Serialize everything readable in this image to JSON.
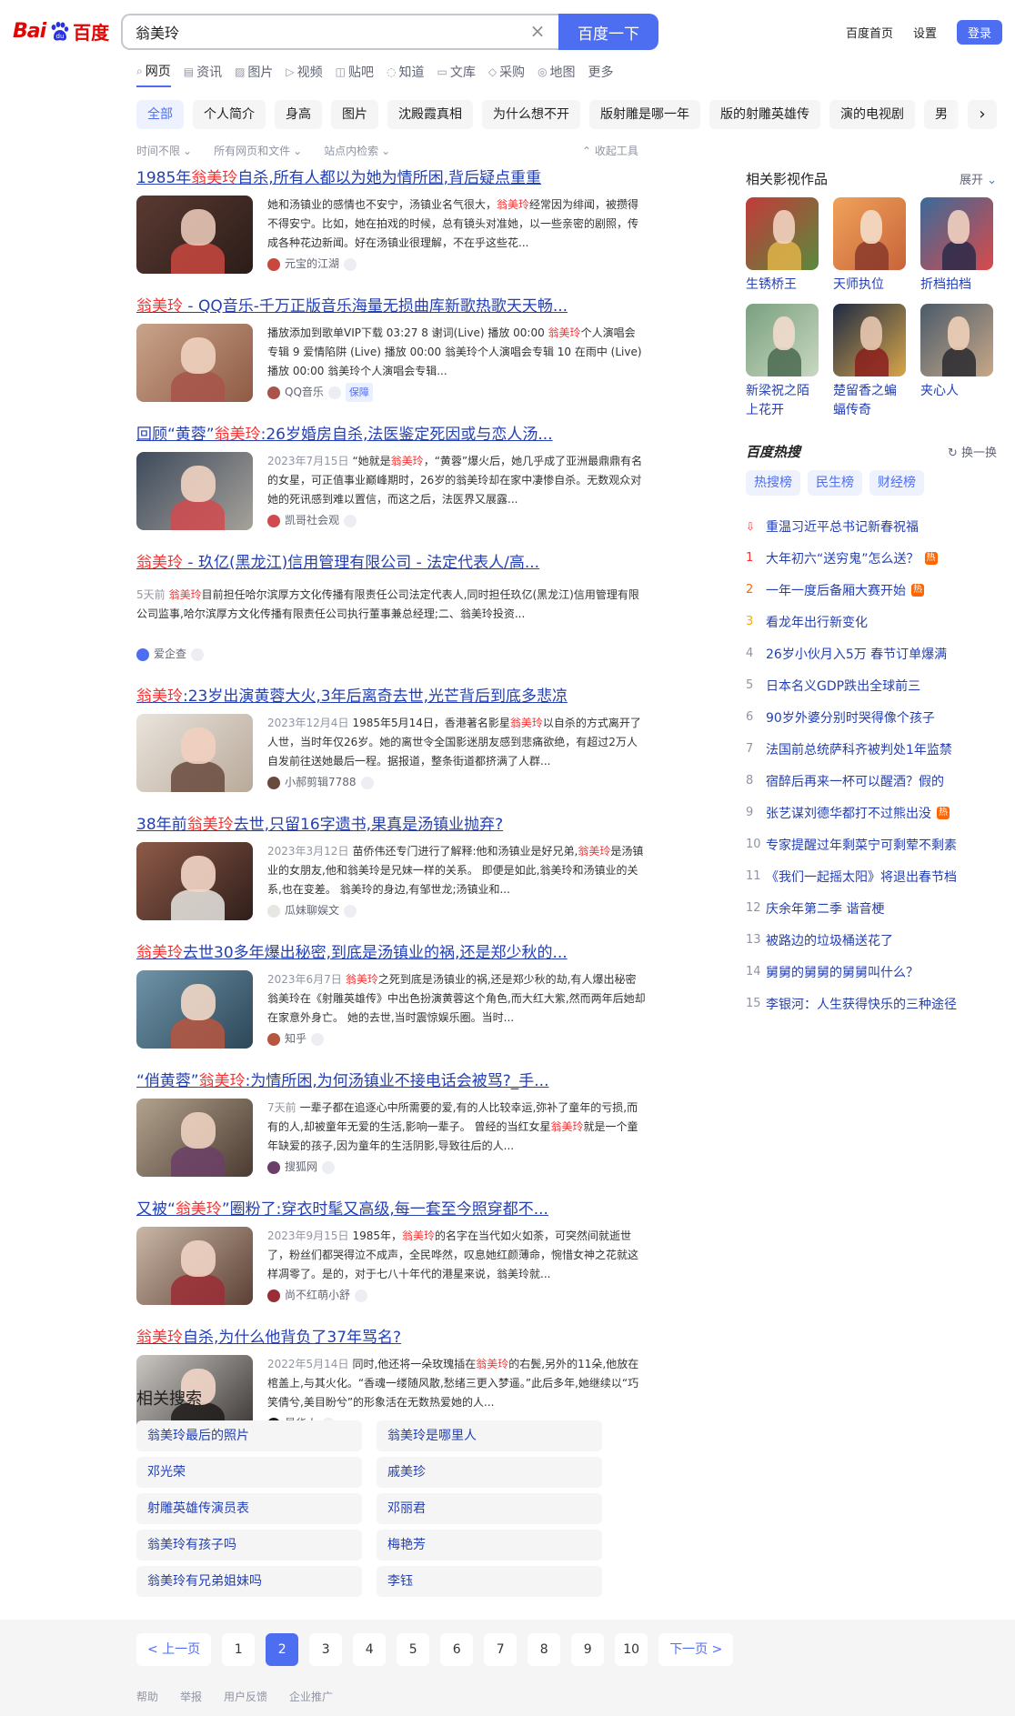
{
  "header": {
    "logo": {
      "part1": "Bai",
      "part2": "百度"
    },
    "query": "翁美玲",
    "search_button": "百度一下",
    "links": [
      "百度首页",
      "设置"
    ],
    "login": "登录"
  },
  "nav_tabs": [
    {
      "label": "网页",
      "icon": "search-icon"
    },
    {
      "label": "资讯",
      "icon": "news-icon"
    },
    {
      "label": "图片",
      "icon": "image-icon"
    },
    {
      "label": "视频",
      "icon": "video-icon"
    },
    {
      "label": "贴吧",
      "icon": "tieba-icon"
    },
    {
      "label": "知道",
      "icon": "zhidao-icon"
    },
    {
      "label": "文库",
      "icon": "wenku-icon"
    },
    {
      "label": "采购",
      "icon": "shop-icon"
    },
    {
      "label": "地图",
      "icon": "map-icon"
    },
    {
      "label": "更多",
      "icon": ""
    }
  ],
  "chips": [
    "全部",
    "个人简介",
    "身高",
    "图片",
    "沈殿霞真相",
    "为什么想不开",
    "版射雕是哪一年",
    "版的射雕英雄传",
    "演的电视剧",
    "男"
  ],
  "filters": [
    "时间不限",
    "所有网页和文件",
    "站点内检索"
  ],
  "collapse_tools": "收起工具",
  "results": [
    {
      "title_parts": [
        [
          "1985年",
          false
        ],
        [
          "翁美玲",
          true
        ],
        [
          "自杀,所有人都以为她为情所困,背后疑点重重",
          false
        ]
      ],
      "date": "",
      "abstract_parts": [
        [
          "她和汤镇业的感情也不安宁，汤镇业名气很大，",
          false
        ],
        [
          "翁美玲",
          true
        ],
        [
          "经常因为绯闻，被攒得不得安宁。比如，她在拍戏的时候，总有镜头对准她，以一些亲密的剧照，传成各种花边新闻。好在汤镇业很理解，不在乎这些花...",
          false
        ]
      ],
      "source": "元宝的江湖",
      "safe": "",
      "colors": [
        "#5a3a32",
        "#2b1c18",
        "#e7c7b6",
        "#c8483f"
      ]
    },
    {
      "title_parts": [
        [
          "翁美玲",
          true
        ],
        [
          " - QQ音乐-千万正版音乐海量无损曲库新歌热歌天天畅...",
          false
        ]
      ],
      "date": "",
      "abstract_parts": [
        [
          "播放添加到歌单VIP下载 03:27 8 谢词(Live) 播放 00:00 ",
          false
        ],
        [
          "翁美玲",
          true
        ],
        [
          "个人演唱会专辑 9 爱情陷阱 (Live) 播放 00:00 翁美玲个人演唱会专辑 10 在雨中 (Live) 播放 00:00 翁美玲个人演唱会专辑...",
          false
        ]
      ],
      "source": "QQ音乐",
      "safe": "保障",
      "colors": [
        "#c9a48a",
        "#8f5a44",
        "#f0d2c0",
        "#a8544a"
      ]
    },
    {
      "title_parts": [
        [
          "回顾“黄蓉”",
          false
        ],
        [
          "翁美玲",
          true
        ],
        [
          ":26岁婚房自杀,法医鉴定死因或与恋人汤...",
          false
        ]
      ],
      "date": "2023年7月15日",
      "abstract_parts": [
        [
          "“她就是",
          false
        ],
        [
          "翁美玲",
          true
        ],
        [
          "，“黄蓉”爆火后，她几乎成了亚洲最鼎鼎有名的女星，可正值事业巅峰期时，26岁的翁美玲却在家中凄惨自杀。无数观众对她的死讯感到难以置信，而这之后，法医界又展露...",
          false
        ]
      ],
      "source": "凯哥社会观",
      "safe": "",
      "colors": [
        "#3d4a5c",
        "#a7a29a",
        "#f1d3c2",
        "#d14a4e"
      ]
    },
    {
      "title_parts": [
        [
          "翁美玲",
          true
        ],
        [
          " - 玖亿(黑龙江)信用管理有限公司 - 法定代表人/高...",
          false
        ]
      ],
      "date": "5天前",
      "abstract_parts": [
        [
          "翁美玲",
          true
        ],
        [
          "目前担任哈尔滨厚方文化传播有限责任公司法定代表人,同时担任玖亿(黑龙江)信用管理有限公司监事,哈尔滨厚方文化传播有限责任公司执行董事兼总经理;二、翁美玲投资...",
          false
        ]
      ],
      "source": "爱企查",
      "safe": "",
      "colors": []
    },
    {
      "title_parts": [
        [
          "翁美玲",
          true
        ],
        [
          ":23岁出演黄蓉大火,3年后离奇去世,光芒背后到底多悲凉",
          false
        ]
      ],
      "date": "2023年12月4日",
      "abstract_parts": [
        [
          "1985年5月14日，香港著名影星",
          false
        ],
        [
          "翁美玲",
          true
        ],
        [
          "以自杀的方式离开了人世，当时年仅26岁。她的离世令全国影迷朋友感到悲痛欲绝，有超过2万人自发前往送她最后一程。据报道，整条街道都挤满了人群...",
          false
        ]
      ],
      "source": "小郝剪辑7788",
      "safe": "",
      "colors": [
        "#e9e4dc",
        "#b9a99a",
        "#f2d0c0",
        "#6a4a3e"
      ]
    },
    {
      "title_parts": [
        [
          "38年前",
          false
        ],
        [
          "翁美玲",
          true
        ],
        [
          "去世,只留16字遗书,果真是汤镇业抛弃?",
          false
        ]
      ],
      "date": "2023年3月12日",
      "abstract_parts": [
        [
          "苗侨伟还专门进行了解释:他和汤镇业是好兄弟,",
          false
        ],
        [
          "翁美玲",
          true
        ],
        [
          "是汤镇业的女朋友,他和翁美玲是兄妹一样的关系。 即便是如此,翁美玲和汤镇业的关系,也在变差。 翁美玲的身边,有邹世龙;汤镇业和...",
          false
        ]
      ],
      "source": "瓜妹聊娱文",
      "safe": "",
      "colors": [
        "#8e5a48",
        "#2f1e1a",
        "#f3d6c8",
        "#e8e6e2"
      ]
    },
    {
      "title_parts": [
        [
          "翁美玲",
          true
        ],
        [
          "去世30多年爆出秘密,到底是汤镇业的祸,还是郑少秋的...",
          false
        ]
      ],
      "date": "2023年6月7日",
      "abstract_parts": [
        [
          "翁美玲",
          true
        ],
        [
          "之死到底是汤镇业的祸,还是郑少秋的劫,有人爆出秘密 翁美玲在《射雕英雄传》中出色扮演黄蓉这个角色,而大红大紫,然而两年后她却在家意外身亡。 她的去世,当时震惊娱乐圈。当时...",
          false
        ]
      ],
      "source": "知乎",
      "safe": "",
      "colors": [
        "#6f93a8",
        "#2c4758",
        "#f2d8c8",
        "#b7563f"
      ]
    },
    {
      "title_parts": [
        [
          "“俏黄蓉”",
          false
        ],
        [
          "翁美玲",
          true
        ],
        [
          ":为情所困,为何汤镇业不接电话会被骂?_手...",
          false
        ]
      ],
      "date": "7天前",
      "abstract_parts": [
        [
          "一辈子都在追逐心中所需要的爱,有的人比较幸运,弥补了童年的亏损,而有的人,却被童年无爱的生活,影响一辈子。 曾经的当红女星",
          false
        ],
        [
          "翁美玲",
          true
        ],
        [
          "就是一个童年缺爱的孩子,因为童年的生活阴影,导致往后的人...",
          false
        ]
      ],
      "source": "搜狐网",
      "safe": "",
      "colors": [
        "#b2a38f",
        "#4a3a30",
        "#ecd0bf",
        "#6b3f67"
      ]
    },
    {
      "title_parts": [
        [
          "又被“",
          false
        ],
        [
          "翁美玲",
          true
        ],
        [
          "”圈粉了:穿衣时髦又高级,每一套至今照穿都不...",
          false
        ]
      ],
      "date": "2023年9月15日",
      "abstract_parts": [
        [
          "1985年，",
          false
        ],
        [
          "翁美玲",
          true
        ],
        [
          "的名字在当代如火如荼，可突然间就逝世了，粉丝们都哭得泣不成声，全民哗然，叹息她红颜薄命，惋惜女神之花就这样凋零了。是的，对于七八十年代的港星来说，翁美玲就...",
          false
        ]
      ],
      "source": "尚不红萌小舒",
      "safe": "",
      "colors": [
        "#c9b7a6",
        "#5c3f34",
        "#f0d4c5",
        "#9a2e36"
      ]
    },
    {
      "title_parts": [
        [
          "翁美玲",
          true
        ],
        [
          "自杀,为什么他背负了37年骂名?",
          false
        ]
      ],
      "date": "2022年5月14日",
      "abstract_parts": [
        [
          "同时,他还将一朵玫瑰插在",
          false
        ],
        [
          "翁美玲",
          true
        ],
        [
          "的右鬓,另外的11朵,他放在棺盖上,与其火化。“香魂一缕随风散,愁绪三更入梦遥。”此后多年,她继续以“巧笑倩兮,美目盼兮”的形象活在无数热爱她的人...",
          false
        ]
      ],
      "source": "最华人",
      "safe": "",
      "colors": [
        "#cbc8c4",
        "#3a3533",
        "#f2d6c8",
        "#1e1b1a"
      ]
    }
  ],
  "related": {
    "title": "相关搜索",
    "items": [
      "翁美玲最后的照片",
      "翁美玲是哪里人",
      "邓光荣",
      "戚美珍",
      "射雕英雄传演员表",
      "邓丽君",
      "翁美玲有孩子吗",
      "梅艳芳",
      "翁美玲有兄弟姐妹吗",
      "李钰"
    ]
  },
  "pagination": {
    "prev": "< 上一页",
    "pages": [
      "1",
      "2",
      "3",
      "4",
      "5",
      "6",
      "7",
      "8",
      "9",
      "10"
    ],
    "current": "2",
    "next": "下一页 >"
  },
  "footer_links": [
    "帮助",
    "举报",
    "用户反馈",
    "企业推广"
  ],
  "sidebar": {
    "works_title": "相关影视作品",
    "works_expand": "展开",
    "works": [
      {
        "name": "生锈桥王",
        "colors": [
          "#c23a3a",
          "#5a8a3c",
          "#f1d2c0",
          "#e0b34a"
        ]
      },
      {
        "name": "天师执位",
        "colors": [
          "#f0a25a",
          "#c8643a",
          "#f4dcc8",
          "#8a3a2a"
        ]
      },
      {
        "name": "折档拍档",
        "colors": [
          "#3a6a9a",
          "#d84a4a",
          "#f0d0c0",
          "#2a2a4a"
        ]
      },
      {
        "name": "新梁祝之陌上花开",
        "colors": [
          "#7aa080",
          "#c8d8c0",
          "#f2dccc",
          "#4a6a50"
        ]
      },
      {
        "name": "楚留香之蝙蝠传奇",
        "colors": [
          "#1e2a44",
          "#d8a64a",
          "#e8c8b0",
          "#8a1e1e"
        ]
      },
      {
        "name": "夹心人",
        "colors": [
          "#4a5a6a",
          "#c8a888",
          "#f0d0b8",
          "#2a2a30"
        ]
      }
    ],
    "hot_title": "百度热搜",
    "hot_refresh": "换一换",
    "hot_tabs": [
      "热搜榜",
      "民生榜",
      "财经榜"
    ],
    "hot_list": [
      {
        "rank": "",
        "text": "重温习近平总书记新春祝福",
        "hot": false
      },
      {
        "rank": "1",
        "text": "大年初六“送穷鬼”怎么送？",
        "hot": true
      },
      {
        "rank": "2",
        "text": "一年一度后备厢大赛开始",
        "hot": true
      },
      {
        "rank": "3",
        "text": "看龙年出行新变化",
        "hot": false
      },
      {
        "rank": "4",
        "text": "26岁小伙月入5万 春节订单爆满",
        "hot": false
      },
      {
        "rank": "5",
        "text": "日本名义GDP跌出全球前三",
        "hot": false
      },
      {
        "rank": "6",
        "text": "90岁外婆分别时哭得像个孩子",
        "hot": false
      },
      {
        "rank": "7",
        "text": "法国前总统萨科齐被判处1年监禁",
        "hot": false
      },
      {
        "rank": "8",
        "text": "宿醉后再来一杯可以醒酒？假的",
        "hot": false
      },
      {
        "rank": "9",
        "text": "张艺谋刘德华都打不过熊出没",
        "hot": true
      },
      {
        "rank": "10",
        "text": "专家提醒过年剩菜宁可剩荤不剩素",
        "hot": false
      },
      {
        "rank": "11",
        "text": "《我们一起摇太阳》将退出春节档",
        "hot": false
      },
      {
        "rank": "12",
        "text": "庆余年第二季 谐音梗",
        "hot": false
      },
      {
        "rank": "13",
        "text": "被路边的垃圾桶送花了",
        "hot": false
      },
      {
        "rank": "14",
        "text": "舅舅的舅舅的舅舅叫什么？",
        "hot": false
      },
      {
        "rank": "15",
        "text": "李银河：人生获得快乐的三种途径",
        "hot": false
      }
    ],
    "hot_tag": "热"
  }
}
